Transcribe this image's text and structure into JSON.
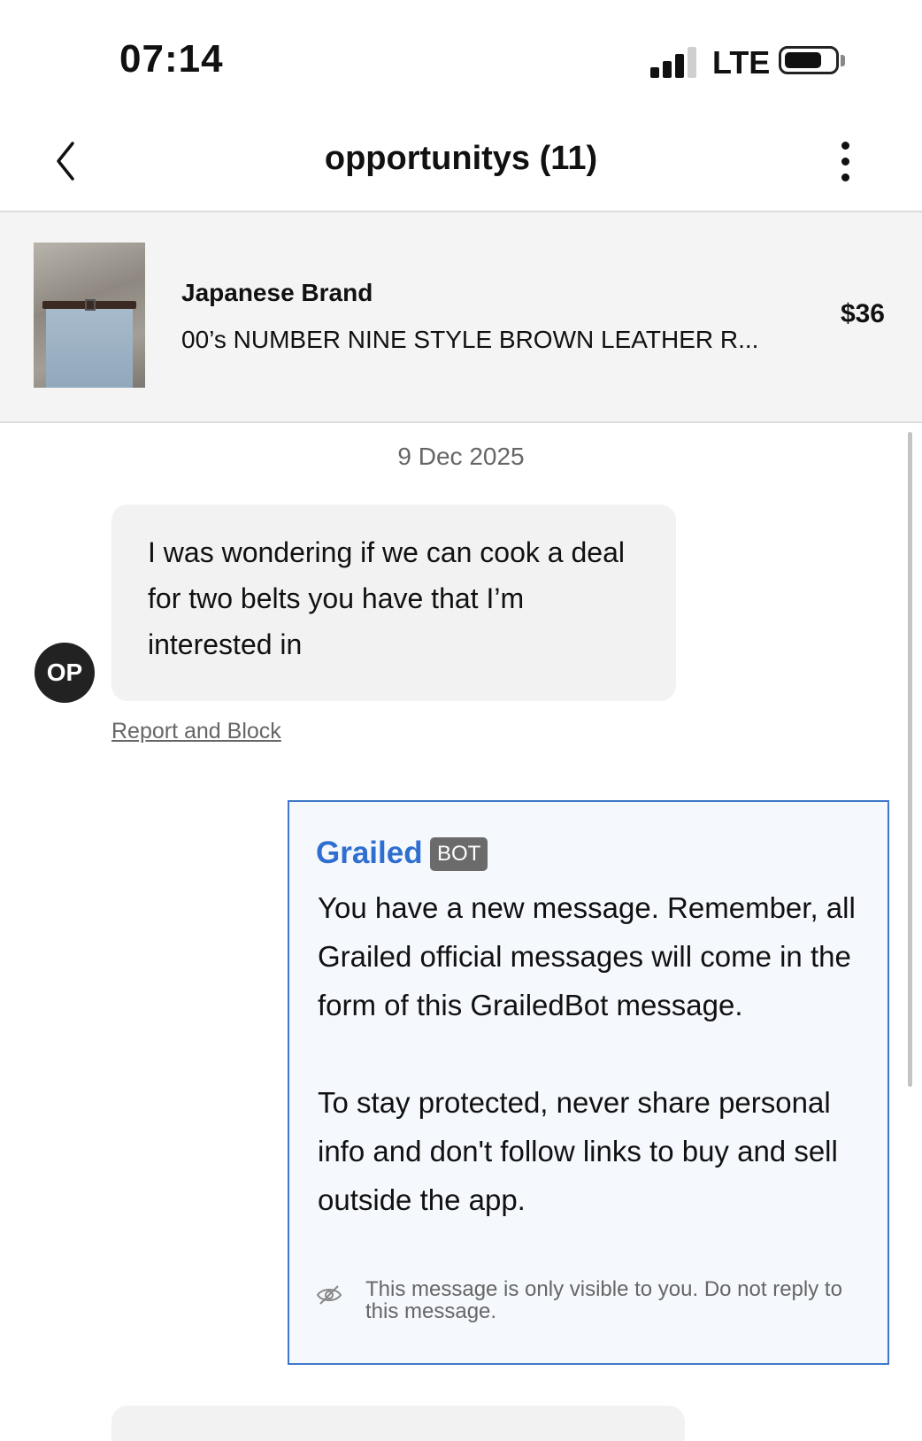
{
  "status_bar": {
    "time": "07:14",
    "network": "LTE",
    "signal_bars": 3,
    "battery_level": 0.75
  },
  "header": {
    "title": "opportunitys (11)",
    "back_icon": "chevron-left-icon",
    "more_icon": "more-vertical-icon"
  },
  "listing": {
    "brand": "Japanese Brand",
    "title": "00’s NUMBER NINE STYLE BROWN LEATHER R...",
    "price": "$36"
  },
  "chat": {
    "date": "9 Dec 2025",
    "messages": [
      {
        "sender_initials": "OP",
        "text": "I was wondering if we can cook a deal for two belts you have that I’m interested in"
      }
    ],
    "report_link": "Report and Block",
    "bot_message": {
      "name": "Grailed",
      "badge": "BOT",
      "paragraph1": "You have a new message. Remember, all Grailed official messages will come in the form of this GrailedBot message.",
      "paragraph2": "To stay protected, never share personal info and don't follow links to buy and sell outside the app.",
      "note": "This message is only visible to you. Do not reply to this message.",
      "note_icon": "eye-off-icon"
    }
  },
  "colors": {
    "accent": "#2f6fd0",
    "bot_border": "#3f78c9",
    "bubble_bg": "#f2f2f2",
    "avatar_bg": "#222222"
  }
}
